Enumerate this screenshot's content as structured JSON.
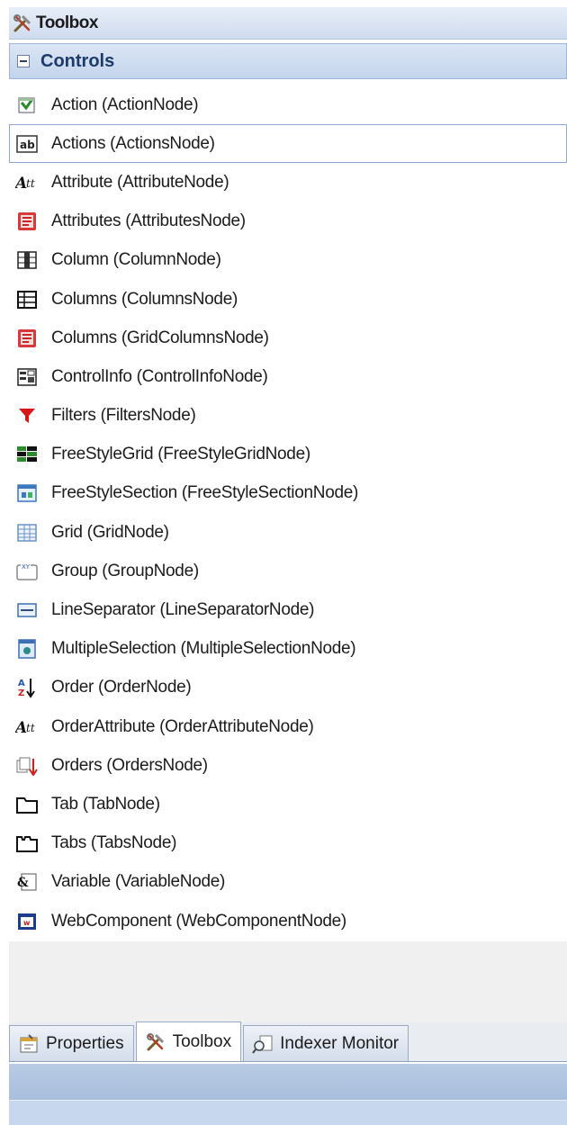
{
  "window": {
    "title": "Toolbox"
  },
  "group": {
    "label": "Controls"
  },
  "items": [
    {
      "label": "Action (ActionNode)",
      "icon": "action-icon"
    },
    {
      "label": "Actions (ActionsNode)",
      "icon": "ab-textbox-icon",
      "selected": true
    },
    {
      "label": "Attribute (AttributeNode)",
      "icon": "attribute-icon"
    },
    {
      "label": "Attributes (AttributesNode)",
      "icon": "list-red-icon"
    },
    {
      "label": "Column (ColumnNode)",
      "icon": "column-icon"
    },
    {
      "label": "Columns (ColumnsNode)",
      "icon": "columns-table-icon"
    },
    {
      "label": "Columns (GridColumnsNode)",
      "icon": "list-red-icon"
    },
    {
      "label": "ControlInfo (ControlInfoNode)",
      "icon": "control-info-icon"
    },
    {
      "label": "Filters (FiltersNode)",
      "icon": "filter-icon"
    },
    {
      "label": "FreeStyleGrid (FreeStyleGridNode)",
      "icon": "freestyle-grid-icon"
    },
    {
      "label": "FreeStyleSection (FreeStyleSectionNode)",
      "icon": "freestyle-section-icon"
    },
    {
      "label": "Grid (GridNode)",
      "icon": "grid-icon"
    },
    {
      "label": "Group (GroupNode)",
      "icon": "group-icon"
    },
    {
      "label": "LineSeparator (LineSeparatorNode)",
      "icon": "line-separator-icon"
    },
    {
      "label": "MultipleSelection (MultipleSelectionNode)",
      "icon": "multiple-selection-icon"
    },
    {
      "label": "Order (OrderNode)",
      "icon": "sort-az-icon"
    },
    {
      "label": "OrderAttribute (OrderAttributeNode)",
      "icon": "attribute-icon"
    },
    {
      "label": "Orders (OrdersNode)",
      "icon": "orders-icon"
    },
    {
      "label": "Tab (TabNode)",
      "icon": "tab-folder-icon"
    },
    {
      "label": "Tabs (TabsNode)",
      "icon": "tabs-folder-icon"
    },
    {
      "label": "Variable (VariableNode)",
      "icon": "variable-icon"
    },
    {
      "label": "WebComponent (WebComponentNode)",
      "icon": "web-component-icon"
    }
  ],
  "tabs": [
    {
      "label": "Properties",
      "icon": "properties-icon"
    },
    {
      "label": "Toolbox",
      "icon": "tools-icon",
      "active": true
    },
    {
      "label": "Indexer Monitor",
      "icon": "indexer-icon"
    }
  ]
}
